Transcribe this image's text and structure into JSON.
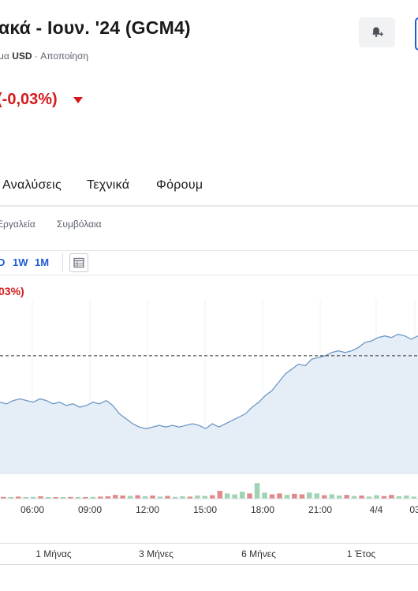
{
  "header": {
    "title": "ακά - Ιουν. '24 (GCM4)",
    "subtitle_prefix": "μα",
    "currency": "USD",
    "subtitle_suffix": "· Αποποίηση"
  },
  "quote": {
    "change_percent": "(-0,03%)"
  },
  "tabs": [
    {
      "label": "Αναλύσεις"
    },
    {
      "label": "Τεχνικά"
    },
    {
      "label": "Φόρουμ"
    }
  ],
  "subnav": [
    {
      "label": "Εργαλεία"
    },
    {
      "label": "Συμβόλαια"
    }
  ],
  "ranges": [
    {
      "label": "D"
    },
    {
      "label": "1W"
    },
    {
      "label": "1M"
    }
  ],
  "chart_header": {
    "change_percent": "03%)"
  },
  "chart_data": {
    "type": "area",
    "x_tick_labels": [
      "06:00",
      "09:00",
      "12:00",
      "15:00",
      "18:00",
      "21:00",
      "4/4",
      "03"
    ],
    "price_series": [
      0.43,
      0.42,
      0.44,
      0.45,
      0.44,
      0.43,
      0.45,
      0.44,
      0.42,
      0.43,
      0.41,
      0.42,
      0.4,
      0.41,
      0.43,
      0.42,
      0.44,
      0.41,
      0.36,
      0.33,
      0.3,
      0.28,
      0.27,
      0.28,
      0.29,
      0.28,
      0.29,
      0.28,
      0.29,
      0.3,
      0.29,
      0.27,
      0.3,
      0.28,
      0.3,
      0.32,
      0.34,
      0.36,
      0.4,
      0.43,
      0.47,
      0.5,
      0.55,
      0.6,
      0.63,
      0.66,
      0.65,
      0.69,
      0.7,
      0.71,
      0.73,
      0.74,
      0.73,
      0.74,
      0.76,
      0.79,
      0.8,
      0.82,
      0.83,
      0.82,
      0.84,
      0.83,
      0.81,
      0.83
    ],
    "reference_line": 0.71,
    "volume_series": [
      {
        "v": 0.1,
        "dir": "down"
      },
      {
        "v": 0.08,
        "dir": "up"
      },
      {
        "v": 0.12,
        "dir": "down"
      },
      {
        "v": 0.06,
        "dir": "up"
      },
      {
        "v": 0.1,
        "dir": "up"
      },
      {
        "v": 0.14,
        "dir": "down"
      },
      {
        "v": 0.08,
        "dir": "up"
      },
      {
        "v": 0.06,
        "dir": "down"
      },
      {
        "v": 0.08,
        "dir": "up"
      },
      {
        "v": 0.1,
        "dir": "down"
      },
      {
        "v": 0.06,
        "dir": "up"
      },
      {
        "v": 0.08,
        "dir": "down"
      },
      {
        "v": 0.1,
        "dir": "up"
      },
      {
        "v": 0.12,
        "dir": "down"
      },
      {
        "v": 0.14,
        "dir": "down"
      },
      {
        "v": 0.22,
        "dir": "down"
      },
      {
        "v": 0.18,
        "dir": "down"
      },
      {
        "v": 0.16,
        "dir": "up"
      },
      {
        "v": 0.2,
        "dir": "down"
      },
      {
        "v": 0.14,
        "dir": "up"
      },
      {
        "v": 0.18,
        "dir": "down"
      },
      {
        "v": 0.12,
        "dir": "up"
      },
      {
        "v": 0.16,
        "dir": "down"
      },
      {
        "v": 0.1,
        "dir": "up"
      },
      {
        "v": 0.14,
        "dir": "up"
      },
      {
        "v": 0.12,
        "dir": "down"
      },
      {
        "v": 0.18,
        "dir": "up"
      },
      {
        "v": 0.16,
        "dir": "up"
      },
      {
        "v": 0.2,
        "dir": "down"
      },
      {
        "v": 0.45,
        "dir": "down"
      },
      {
        "v": 0.3,
        "dir": "up"
      },
      {
        "v": 0.25,
        "dir": "up"
      },
      {
        "v": 0.4,
        "dir": "up"
      },
      {
        "v": 0.3,
        "dir": "down"
      },
      {
        "v": 0.9,
        "dir": "up"
      },
      {
        "v": 0.35,
        "dir": "up"
      },
      {
        "v": 0.25,
        "dir": "down"
      },
      {
        "v": 0.3,
        "dir": "down"
      },
      {
        "v": 0.22,
        "dir": "up"
      },
      {
        "v": 0.28,
        "dir": "down"
      },
      {
        "v": 0.25,
        "dir": "down"
      },
      {
        "v": 0.35,
        "dir": "up"
      },
      {
        "v": 0.3,
        "dir": "up"
      },
      {
        "v": 0.2,
        "dir": "down"
      },
      {
        "v": 0.25,
        "dir": "up"
      },
      {
        "v": 0.18,
        "dir": "up"
      },
      {
        "v": 0.22,
        "dir": "down"
      },
      {
        "v": 0.15,
        "dir": "up"
      },
      {
        "v": 0.18,
        "dir": "down"
      },
      {
        "v": 0.12,
        "dir": "up"
      },
      {
        "v": 0.2,
        "dir": "up"
      },
      {
        "v": 0.15,
        "dir": "down"
      },
      {
        "v": 0.22,
        "dir": "down"
      },
      {
        "v": 0.14,
        "dir": "up"
      },
      {
        "v": 0.18,
        "dir": "up"
      },
      {
        "v": 0.12,
        "dir": "up"
      }
    ],
    "grid": true,
    "colors": {
      "line": "#6f97c6",
      "area": "#e5eef7",
      "reference": "#333333",
      "volume_up": "#9fd3b6",
      "volume_down": "#e08a8a",
      "grid": "#eef0f3",
      "axis_text": "#333333"
    }
  },
  "periods": [
    {
      "label": "1 Μήνας"
    },
    {
      "label": "3 Μήνες"
    },
    {
      "label": "6 Μήνες"
    },
    {
      "label": "1 Έτος"
    }
  ],
  "icons": {
    "bell": "bell-plus-icon",
    "caret": "caret-down-icon",
    "table": "table-view-icon"
  }
}
